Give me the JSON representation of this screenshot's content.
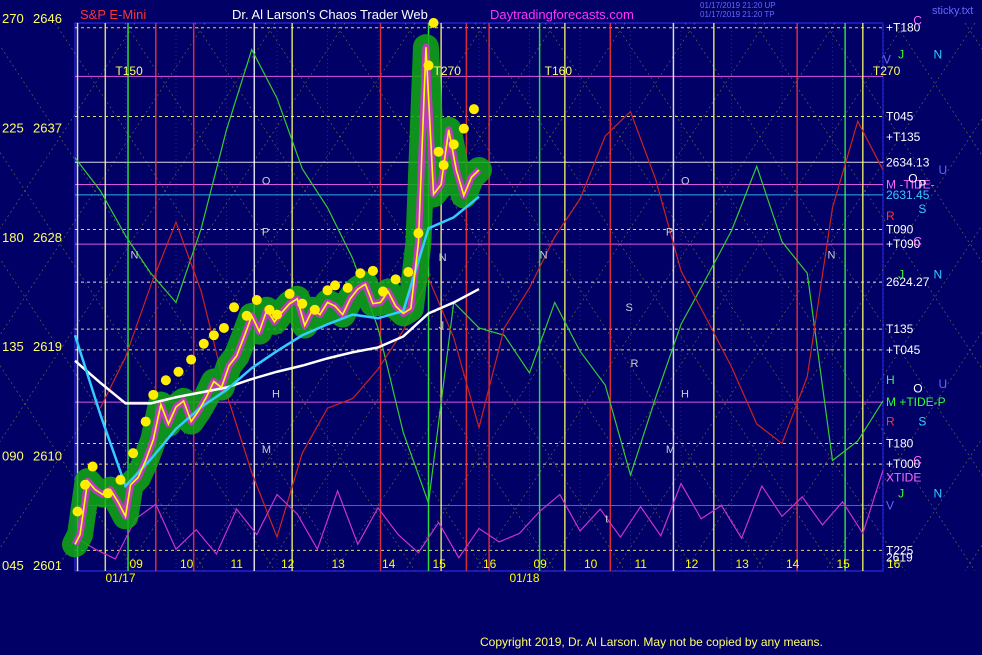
{
  "header": {
    "symbol": "S&P E-Mini",
    "title": "Dr. Al Larson's Chaos Trader Web",
    "site": "Daytradingforecasts.com",
    "stamp_line1": "01/17/2019 21:20 UP",
    "stamp_line2": "01/17/2019 21:20 TP",
    "sticky": "sticky.txt"
  },
  "copyright": "Copyright 2019, Dr. Al Larson. May not be copied by any means.",
  "colors": {
    "background": "#000066",
    "grid": "#2222aa",
    "price": "#ffff00",
    "fast_avg": "#33ccff",
    "slow_avg": "#ffffff",
    "green_flux": "#33cc33",
    "red_flux": "#cc2222",
    "magenta_flux": "#cc33cc",
    "dots": "#ffee00"
  },
  "chart_data": {
    "type": "line",
    "ylim": [
      2601,
      2646
    ],
    "y_ticks": [
      {
        "deg": "270",
        "price": "2646",
        "value": 2646
      },
      {
        "deg": "225",
        "price": "2637",
        "value": 2637
      },
      {
        "deg": "180",
        "price": "2628",
        "value": 2628
      },
      {
        "deg": "135",
        "price": "2619",
        "value": 2619
      },
      {
        "deg": "090",
        "price": "2610",
        "value": 2610
      },
      {
        "deg": "045",
        "price": "2601",
        "value": 2601
      }
    ],
    "xlim": [
      8,
      24
    ],
    "x_ticks": [
      {
        "label": "09",
        "x": 9
      },
      {
        "label": "10",
        "x": 10
      },
      {
        "label": "11",
        "x": 11
      },
      {
        "label": "12",
        "x": 12
      },
      {
        "label": "13",
        "x": 13
      },
      {
        "label": "14",
        "x": 14
      },
      {
        "label": "15",
        "x": 15
      },
      {
        "label": "16",
        "x": 16
      },
      {
        "label": "09",
        "x": 17
      },
      {
        "label": "10",
        "x": 18
      },
      {
        "label": "11",
        "x": 19
      },
      {
        "label": "12",
        "x": 20
      },
      {
        "label": "13",
        "x": 21
      },
      {
        "label": "14",
        "x": 22
      },
      {
        "label": "15",
        "x": 23
      },
      {
        "label": "16",
        "x": 24
      }
    ],
    "dates": [
      {
        "label": "01/17",
        "x": 9
      },
      {
        "label": "01/18",
        "x": 17
      }
    ],
    "top_labels": [
      {
        "label": "T150",
        "x": 8.8
      },
      {
        "label": "T270",
        "x": 15.1
      },
      {
        "label": "T160",
        "x": 17.3
      },
      {
        "label": "T270",
        "x": 23.8
      }
    ],
    "chart_marks": [
      {
        "label": "O",
        "x": 11.7,
        "y": 2632.3
      },
      {
        "label": "P",
        "x": 11.7,
        "y": 2628.1
      },
      {
        "label": "M",
        "x": 11.7,
        "y": 2610.2
      },
      {
        "label": "H",
        "x": 11.9,
        "y": 2614.8
      },
      {
        "label": "N",
        "x": 9.1,
        "y": 2626.2
      },
      {
        "label": "J",
        "x": 15.2,
        "y": 2620.4
      },
      {
        "label": "N",
        "x": 15.2,
        "y": 2626.0
      },
      {
        "label": "N",
        "x": 17.2,
        "y": 2626.2
      },
      {
        "label": "O",
        "x": 20.0,
        "y": 2632.3
      },
      {
        "label": "P",
        "x": 19.7,
        "y": 2628.1
      },
      {
        "label": "S",
        "x": 18.9,
        "y": 2621.9
      },
      {
        "label": "R",
        "x": 19.0,
        "y": 2617.3
      },
      {
        "label": "H",
        "x": 20.0,
        "y": 2614.8
      },
      {
        "label": "M",
        "x": 19.7,
        "y": 2610.2
      },
      {
        "label": "N",
        "x": 22.9,
        "y": 2626.2
      },
      {
        "label": "t",
        "x": 18.5,
        "y": 2604.5
      }
    ],
    "right_labels": [
      {
        "label": "+T180",
        "y": 2645.2,
        "color": "#ffffff"
      },
      {
        "label": "T045",
        "y": 2637.9,
        "color": "#ffffff"
      },
      {
        "label": "+T135",
        "y": 2636.2,
        "color": "#ffffff"
      },
      {
        "label": "2634.13",
        "y": 2634.13,
        "color": "#ffffff"
      },
      {
        "label": "M -TIDE-",
        "y": 2632.3,
        "color": "#ff66ff"
      },
      {
        "label": "2631.45",
        "y": 2631.45,
        "color": "#33ccff"
      },
      {
        "label": "R",
        "y": 2629.7,
        "color": "#ff3333"
      },
      {
        "label": "T090",
        "y": 2628.6,
        "color": "#ffffff"
      },
      {
        "label": "+T090",
        "y": 2627.4,
        "color": "#ffffff"
      },
      {
        "label": "2624.27",
        "y": 2624.27,
        "color": "#ffffff"
      },
      {
        "label": "T135",
        "y": 2620.4,
        "color": "#ffffff"
      },
      {
        "label": "+T045",
        "y": 2618.7,
        "color": "#ffffff"
      },
      {
        "label": "H",
        "y": 2616.2,
        "color": "#33ff33"
      },
      {
        "label": "M +TIDE-P",
        "y": 2614.4,
        "color": "#33ff33"
      },
      {
        "label": "R",
        "y": 2612.8,
        "color": "#ff3333"
      },
      {
        "label": "T180",
        "y": 2611.0,
        "color": "#ffffff"
      },
      {
        "label": "+T000",
        "y": 2609.3,
        "color": "#ffffff"
      },
      {
        "label": "XTIDE",
        "y": 2608.2,
        "color": "#ff66ff"
      },
      {
        "label": "V",
        "y": 2605.9,
        "color": "#6666ff"
      },
      {
        "label": "T225",
        "y": 2602.2,
        "color": "#ffffff"
      },
      {
        "label": "2619",
        "y": 2601.6,
        "color": "#ffffff"
      }
    ],
    "far_right_labels": [
      {
        "label": "C",
        "x": 24.6,
        "y": 2645.8,
        "color": "#ff66ff"
      },
      {
        "label": "J",
        "x": 24.3,
        "y": 2643.0,
        "color": "#33ff33"
      },
      {
        "label": "N",
        "x": 25.0,
        "y": 2643.0,
        "color": "#33ccff"
      },
      {
        "label": "V",
        "x": 24.0,
        "y": 2642.6,
        "color": "#6666ff"
      },
      {
        "label": "U",
        "x": 25.1,
        "y": 2633.5,
        "color": "#6666ff"
      },
      {
        "label": "O",
        "x": 24.5,
        "y": 2632.8,
        "color": "#ffffff"
      },
      {
        "label": "P",
        "x": 24.7,
        "y": 2632.3,
        "color": "#ffffff"
      },
      {
        "label": "S",
        "x": 24.7,
        "y": 2630.3,
        "color": "#33ccff"
      },
      {
        "label": "C",
        "x": 24.6,
        "y": 2627.6,
        "color": "#ff66ff"
      },
      {
        "label": "J",
        "x": 24.3,
        "y": 2624.9,
        "color": "#33ff33"
      },
      {
        "label": "N",
        "x": 25.0,
        "y": 2624.9,
        "color": "#33ccff"
      },
      {
        "label": "U",
        "x": 25.1,
        "y": 2615.9,
        "color": "#6666ff"
      },
      {
        "label": "O",
        "x": 24.6,
        "y": 2615.5,
        "color": "#ffffff"
      },
      {
        "label": "S",
        "x": 24.7,
        "y": 2612.8,
        "color": "#33ccff"
      },
      {
        "label": "C",
        "x": 24.6,
        "y": 2609.6,
        "color": "#ff66ff"
      },
      {
        "label": "J",
        "x": 24.3,
        "y": 2606.9,
        "color": "#33ff33"
      },
      {
        "label": "N",
        "x": 25.0,
        "y": 2606.9,
        "color": "#33ccff"
      }
    ],
    "series": [
      {
        "kind": "price",
        "x": [
          8.0,
          8.1,
          8.25,
          8.4,
          8.55,
          8.7,
          8.85,
          9.0,
          9.1,
          9.25,
          9.4,
          9.55,
          9.7,
          9.85,
          10.0,
          10.15,
          10.3,
          10.45,
          10.6,
          10.75,
          10.9,
          11.05,
          11.2,
          11.35,
          11.5,
          11.65,
          11.8,
          11.95,
          12.1,
          12.25,
          12.4,
          12.55,
          12.7,
          12.85,
          13.0,
          13.15,
          13.3,
          13.45,
          13.6,
          13.75,
          13.9,
          14.05,
          14.2,
          14.35,
          14.5,
          14.65,
          14.8,
          14.95,
          15.1,
          15.25,
          15.4,
          15.55,
          15.7,
          15.85,
          16.0
        ],
        "values": [
          2602.7,
          2603.5,
          2607.9,
          2607.2,
          2606.8,
          2607.2,
          2606.2,
          2605.0,
          2607.6,
          2608.2,
          2609.6,
          2611.3,
          2614.2,
          2612.6,
          2614.0,
          2614.5,
          2612.8,
          2613.7,
          2614.8,
          2616.1,
          2615.6,
          2617.4,
          2618.2,
          2619.8,
          2621.5,
          2620.2,
          2622.0,
          2621.0,
          2621.8,
          2622.5,
          2622.9,
          2620.7,
          2622.0,
          2621.6,
          2622.6,
          2622.3,
          2621.6,
          2622.9,
          2623.7,
          2624.1,
          2622.5,
          2622.6,
          2623.5,
          2622.3,
          2621.7,
          2622.1,
          2627.5,
          2643.6,
          2631.5,
          2632.3,
          2636.8,
          2633.5,
          2631.4,
          2632.9,
          2633.5
        ]
      },
      {
        "kind": "fast_avg",
        "x": [
          8.0,
          8.5,
          9.0,
          9.5,
          10.0,
          10.5,
          11.0,
          11.5,
          12.0,
          12.5,
          13.0,
          13.5,
          14.0,
          14.5,
          15.0,
          15.5,
          16.0
        ],
        "values": [
          2619.9,
          2613.4,
          2607.5,
          2609.7,
          2612.2,
          2614.0,
          2615.4,
          2617.2,
          2618.6,
          2619.9,
          2620.8,
          2621.6,
          2621.3,
          2621.9,
          2628.7,
          2629.6,
          2631.3
        ]
      },
      {
        "kind": "slow_avg",
        "x": [
          8.0,
          8.5,
          9.0,
          9.5,
          10.0,
          10.5,
          11.0,
          11.5,
          12.0,
          12.5,
          13.0,
          13.5,
          14.0,
          14.5,
          15.0,
          15.5,
          16.0
        ],
        "values": [
          2617.8,
          2616.0,
          2614.3,
          2614.3,
          2614.8,
          2615.2,
          2615.6,
          2616.3,
          2616.9,
          2617.4,
          2618.0,
          2618.5,
          2618.9,
          2619.8,
          2621.7,
          2622.6,
          2623.7
        ]
      },
      {
        "kind": "green_flux",
        "x": [
          8.0,
          8.5,
          9.0,
          9.5,
          10.0,
          10.5,
          11.0,
          11.5,
          12.0,
          12.5,
          13.0,
          13.5,
          14.0,
          14.5,
          15.0,
          15.5,
          16.0,
          16.5,
          17.0,
          17.5,
          18.0,
          18.5,
          19.0,
          19.5,
          20.0,
          20.5,
          21.0,
          21.5,
          22.0,
          22.5,
          23.0,
          23.5,
          24.0
        ],
        "values": [
          2634.5,
          2631.8,
          2628.1,
          2625.0,
          2622.6,
          2628.7,
          2636.8,
          2643.4,
          2639.4,
          2633.6,
          2630.4,
          2626.2,
          2620.5,
          2611.9,
          2606.1,
          2622.6,
          2620.5,
          2619.9,
          2616.8,
          2622.6,
          2618.6,
          2615.8,
          2608.4,
          2614.8,
          2620.8,
          2624.6,
          2628.5,
          2633.8,
          2627.6,
          2625.0,
          2609.6,
          2611.2,
          2614.5
        ]
      },
      {
        "kind": "red_flux",
        "x": [
          8.5,
          9.0,
          9.5,
          10.0,
          10.5,
          11.0,
          11.5,
          12.0,
          12.5,
          13.0,
          13.5,
          14.0,
          14.5,
          15.0,
          15.5,
          16.0,
          16.5,
          17.0,
          17.5,
          18.0,
          18.5,
          19.0,
          19.5,
          20.0,
          20.5,
          21.0,
          21.5,
          22.0,
          22.5,
          23.0,
          23.5,
          24.0
        ],
        "values": [
          2613.9,
          2618.1,
          2624.0,
          2629.2,
          2623.5,
          2615.1,
          2608.6,
          2603.3,
          2610.2,
          2613.9,
          2614.7,
          2617.1,
          2620.3,
          2624.6,
          2619.7,
          2612.3,
          2620.5,
          2623.8,
          2628.0,
          2631.1,
          2636.3,
          2638.3,
          2632.7,
          2625.2,
          2621.3,
          2617.3,
          2612.6,
          2611.0,
          2616.5,
          2630.4,
          2637.5,
          2633.5
        ]
      },
      {
        "kind": "magenta_flux",
        "x": [
          8.0,
          8.4,
          8.8,
          9.2,
          9.6,
          10.0,
          10.4,
          10.8,
          11.2,
          11.6,
          12.0,
          12.4,
          12.8,
          13.2,
          13.6,
          14.0,
          14.4,
          14.8,
          15.2,
          15.6,
          16.0,
          16.4,
          16.8,
          17.2,
          17.6,
          18.0,
          18.4,
          18.8,
          19.2,
          19.6,
          20.0,
          20.4,
          20.8,
          21.2,
          21.6,
          22.0,
          22.4,
          22.8,
          23.2,
          23.6,
          24.0
        ],
        "values": [
          2603.3,
          2602.3,
          2601.5,
          2604.8,
          2606.0,
          2602.3,
          2603.9,
          2601.9,
          2605.6,
          2603.5,
          2606.8,
          2605.2,
          2602.3,
          2607.1,
          2602.7,
          2605.7,
          2603.5,
          2602.0,
          2604.5,
          2601.6,
          2604.0,
          2602.9,
          2603.6,
          2605.4,
          2606.8,
          2603.8,
          2605.6,
          2603.3,
          2605.8,
          2603.4,
          2607.7,
          2604.8,
          2605.9,
          2603.2,
          2607.5,
          2605.0,
          2606.6,
          2604.3,
          2606.2,
          2603.6,
          2608.8
        ]
      }
    ],
    "yellow_dots": {
      "x": [
        8.05,
        8.2,
        8.35,
        8.65,
        8.9,
        9.15,
        9.4,
        9.55,
        9.8,
        10.05,
        10.3,
        10.55,
        10.75,
        10.95,
        11.15,
        11.4,
        11.6,
        11.85,
        12.0,
        12.25,
        12.5,
        12.75,
        13.0,
        13.15,
        13.4,
        13.65,
        13.9,
        14.1,
        14.35,
        14.6,
        14.8,
        15.0,
        15.1,
        15.2,
        15.3,
        15.5,
        15.7,
        15.9
      ],
      "values": [
        2605.4,
        2607.6,
        2609.1,
        2606.9,
        2608.0,
        2610.2,
        2612.8,
        2615.0,
        2616.2,
        2616.9,
        2617.9,
        2619.2,
        2619.9,
        2620.5,
        2622.2,
        2621.5,
        2622.8,
        2622.0,
        2621.6,
        2623.3,
        2622.5,
        2622.0,
        2623.6,
        2624.0,
        2623.8,
        2625.0,
        2625.2,
        2623.5,
        2624.5,
        2625.1,
        2628.3,
        2642.1,
        2645.6,
        2635.0,
        2633.9,
        2635.6,
        2636.9,
        2638.5
      ]
    },
    "vertical_lines": [
      {
        "x": 8.05,
        "color": "#ffffff"
      },
      {
        "x": 8.6,
        "color": "#ffff66"
      },
      {
        "x": 9.05,
        "color": "#33ff33"
      },
      {
        "x": 9.6,
        "color": "#ff3333"
      },
      {
        "x": 10.35,
        "color": "#ff3333"
      },
      {
        "x": 11.55,
        "color": "#ffffff"
      },
      {
        "x": 12.3,
        "color": "#ffff66"
      },
      {
        "x": 14.05,
        "color": "#ff3333"
      },
      {
        "x": 15.0,
        "color": "#33ff33"
      },
      {
        "x": 15.25,
        "color": "#ffff66"
      },
      {
        "x": 15.75,
        "color": "#ff3333"
      },
      {
        "x": 16.2,
        "color": "#ff3333"
      },
      {
        "x": 17.2,
        "color": "#33ff33"
      },
      {
        "x": 17.7,
        "color": "#ffff66"
      },
      {
        "x": 18.6,
        "color": "#ff3333"
      },
      {
        "x": 19.85,
        "color": "#ffffff"
      },
      {
        "x": 20.65,
        "color": "#ffff66"
      },
      {
        "x": 22.3,
        "color": "#ff3333"
      },
      {
        "x": 23.25,
        "color": "#33ff33"
      },
      {
        "x": 23.6,
        "color": "#ffff66"
      }
    ],
    "horizontal_lines": [
      {
        "y": 2645.2,
        "color": "#ffff66",
        "dash": true
      },
      {
        "y": 2641.2,
        "color": "#ff66ff",
        "dash": false
      },
      {
        "y": 2637.9,
        "color": "#ffff66",
        "dash": true
      },
      {
        "y": 2634.13,
        "color": "#ffffff",
        "dash": false
      },
      {
        "y": 2632.3,
        "color": "#ff66ff",
        "dash": false
      },
      {
        "y": 2631.45,
        "color": "#33ccff",
        "dash": false
      },
      {
        "y": 2628.6,
        "color": "#ffff66",
        "dash": true
      },
      {
        "y": 2627.4,
        "color": "#ff66ff",
        "dash": false
      },
      {
        "y": 2624.27,
        "color": "#ffffff",
        "dash": true
      },
      {
        "y": 2620.4,
        "color": "#ffff66",
        "dash": true
      },
      {
        "y": 2618.7,
        "color": "#ffff66",
        "dash": true
      },
      {
        "y": 2614.4,
        "color": "#ff66ff",
        "dash": false
      },
      {
        "y": 2611.0,
        "color": "#ffff66",
        "dash": true
      },
      {
        "y": 2609.3,
        "color": "#ffff66",
        "dash": true
      },
      {
        "y": 2605.9,
        "color": "#6666ff",
        "dash": false
      },
      {
        "y": 2602.2,
        "color": "#ffff66",
        "dash": true
      }
    ]
  }
}
